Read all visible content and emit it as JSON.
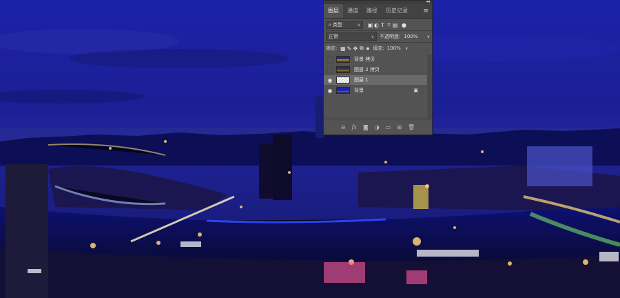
{
  "tabs": [
    "图层",
    "通道",
    "路径",
    "历史记录"
  ],
  "filter": {
    "label": "类型"
  },
  "blend": {
    "mode": "正常",
    "opacity_label": "不透明度:",
    "opacity_value": "100%"
  },
  "lock": {
    "label": "锁定:",
    "fill_label": "填充:",
    "fill_value": "100%"
  },
  "layers": [
    {
      "name": "背景 拷贝",
      "visible": false,
      "selected": false
    },
    {
      "name": "图层 2 拷贝",
      "visible": false,
      "selected": false
    },
    {
      "name": "图层 1",
      "visible": true,
      "selected": true
    },
    {
      "name": "背景",
      "visible": true,
      "selected": false,
      "locked": true
    }
  ],
  "icons": {
    "tab_menu": "panel-menu-icon",
    "filter": [
      "image-filter-icon",
      "adjustment-filter-icon",
      "type-filter-icon",
      "shape-filter-icon",
      "smart-object-filter-icon"
    ],
    "lock": [
      "lock-transparent-pixels-icon",
      "lock-image-pixels-icon",
      "lock-position-icon",
      "lock-artboard-icon",
      "lock-all-icon"
    ],
    "footer": [
      "link-layers-icon",
      "fx-icon",
      "add-mask-icon",
      "adjustment-layer-icon",
      "new-group-icon",
      "new-layer-icon",
      "delete-layer-icon"
    ]
  },
  "colors": {
    "panel_bg": "#535353",
    "sky": "#1a1f8a"
  }
}
